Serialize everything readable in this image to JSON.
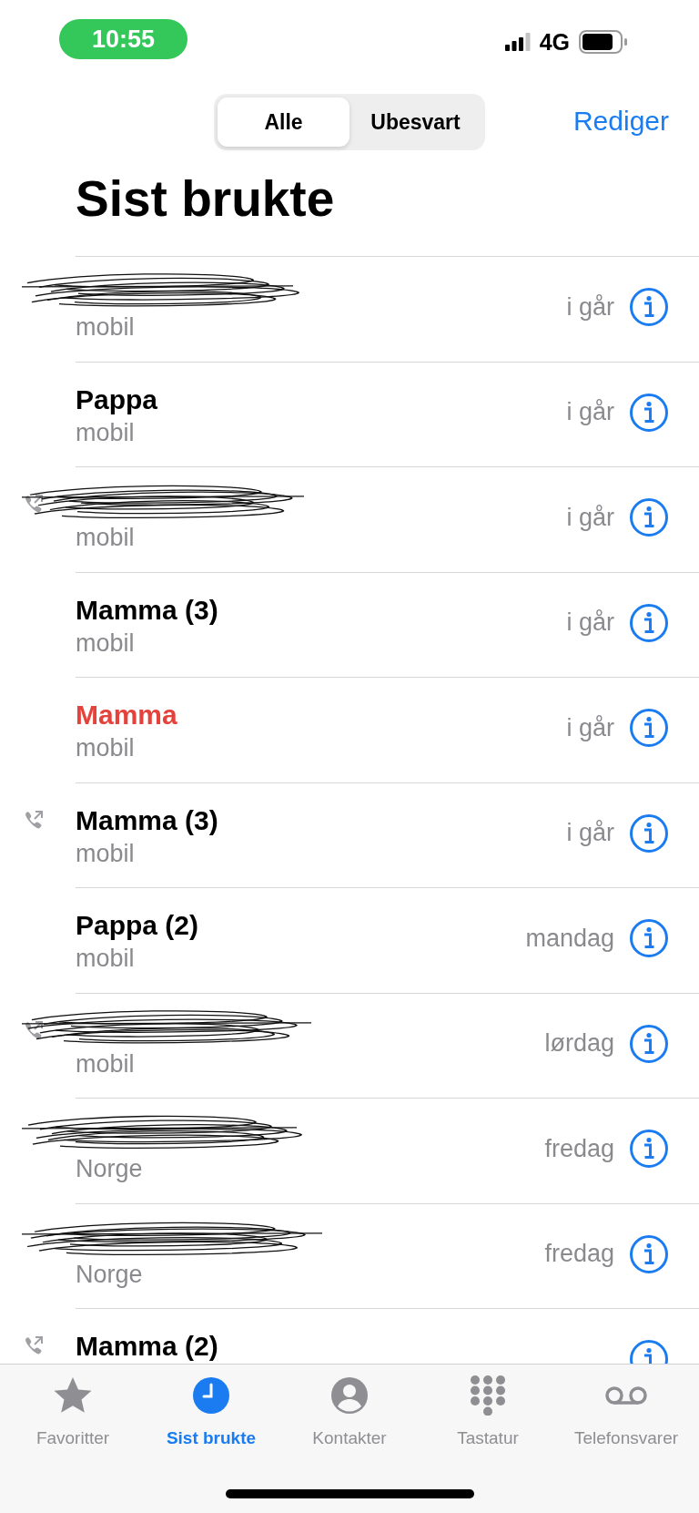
{
  "status_bar": {
    "time": "10:55",
    "network": "4G"
  },
  "segments": [
    {
      "label": "Alle",
      "selected": true
    },
    {
      "label": "Ubesvart",
      "selected": false
    }
  ],
  "edit_button": "Rediger",
  "title": "Sist brukte",
  "calls": [
    {
      "redacted": true,
      "outgoing": false,
      "missed": false,
      "type": "mobil",
      "date": "i går"
    },
    {
      "name": "Pappa",
      "outgoing": false,
      "missed": false,
      "type": "mobil",
      "date": "i går"
    },
    {
      "redacted": true,
      "outgoing": true,
      "missed": false,
      "type": "mobil",
      "date": "i går"
    },
    {
      "name": "Mamma (3)",
      "outgoing": false,
      "missed": false,
      "type": "mobil",
      "date": "i går"
    },
    {
      "name": "Mamma",
      "outgoing": false,
      "missed": true,
      "type": "mobil",
      "date": "i går"
    },
    {
      "name": "Mamma (3)",
      "outgoing": true,
      "missed": false,
      "type": "mobil",
      "date": "i går"
    },
    {
      "name": "Pappa (2)",
      "outgoing": false,
      "missed": false,
      "type": "mobil",
      "date": "mandag"
    },
    {
      "redacted": true,
      "outgoing": true,
      "missed": false,
      "type": "mobil",
      "date": "lørdag"
    },
    {
      "redacted": true,
      "outgoing": false,
      "missed": false,
      "type": "Norge",
      "date": "fredag"
    },
    {
      "redacted": true,
      "outgoing": false,
      "missed": false,
      "type": "Norge",
      "date": "fredag"
    },
    {
      "name": "Mamma (2)",
      "outgoing": true,
      "missed": false
    }
  ],
  "tab_bar": [
    {
      "kind": "star",
      "label": "Favoritter",
      "selected": false
    },
    {
      "kind": "clock",
      "label": "Sist brukte",
      "selected": true
    },
    {
      "kind": "person",
      "label": "Kontakter",
      "selected": false
    },
    {
      "kind": "keypad",
      "label": "Tastatur",
      "selected": false
    },
    {
      "kind": "voicemail",
      "label": "Telefonsvarer",
      "selected": false
    }
  ]
}
